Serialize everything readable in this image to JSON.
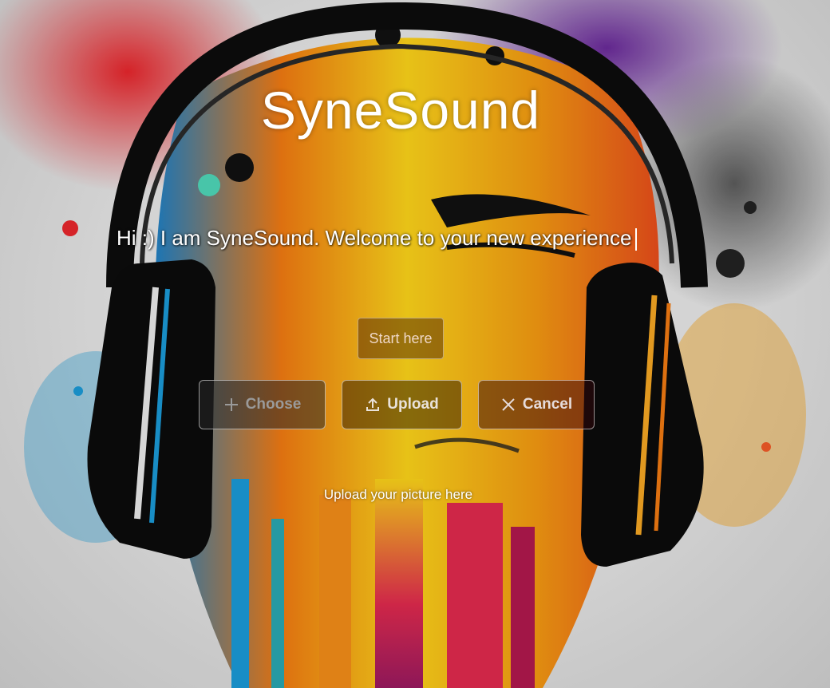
{
  "app": {
    "title": "SyneSound",
    "welcome_message": "Hi :) I am SyneSound. Welcome to your new experience"
  },
  "actions": {
    "start_label": "Start here",
    "choose_label": "Choose",
    "upload_label": "Upload",
    "cancel_label": "Cancel"
  },
  "upload_hint": "Upload your picture here",
  "icons": {
    "choose": "plus-icon",
    "upload": "upload-icon",
    "cancel": "close-icon"
  },
  "colors": {
    "title_text": "#ffffff",
    "background_light": "#e8e8e8",
    "headphones": "#0d0d0d"
  }
}
